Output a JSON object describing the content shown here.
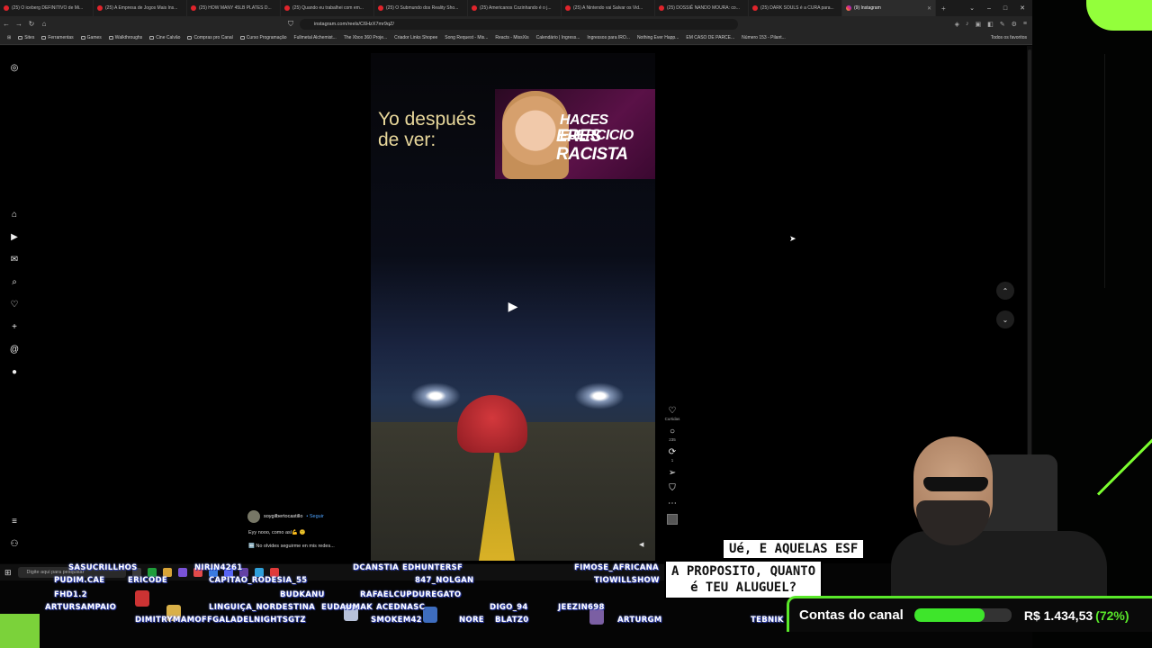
{
  "tabs": [
    {
      "label": "(25) O iceberg DEFINITIVO de Mi...",
      "active": false
    },
    {
      "label": "(25) A Empresa de Jogos Mais Ins...",
      "active": false
    },
    {
      "label": "(25) HOW MANY 45LB PLATES D...",
      "active": false
    },
    {
      "label": "(25) Quando eu trabalhei com em...",
      "active": false
    },
    {
      "label": "(25) O Submundo dos Reality Sho...",
      "active": false
    },
    {
      "label": "(25) Americanos Cozinhando é o j...",
      "active": false
    },
    {
      "label": "(25) A Nintendo vai Salvar os Vid...",
      "active": false
    },
    {
      "label": "(25) DOSSIÊ NANDO MOURA: co...",
      "active": false
    },
    {
      "label": "(25) DARK SOULS é a CURA para...",
      "active": false
    },
    {
      "label": "(9) Instagram",
      "active": true
    }
  ],
  "url": "instagram.com/reels/C6HzX7mr9qZ/",
  "bookmarks": [
    "Sites",
    "Ferramentas",
    "Games",
    "Walkthroughs",
    "Cine Calvão",
    "Compras pro Canal",
    "Curso Programação",
    "Fullmetal Alchemist...",
    "The Xbox 360 Proje...",
    "Criador Links Shopee",
    "Song Request - Mis...",
    "Reacts - MissXis",
    "Calendário | Ingress...",
    "Ingressos para IRO...",
    "Nothing Ever Happ...",
    "EM CASO DE PARCE...",
    "Número 153 - Pilant..."
  ],
  "bookmarks_all": "Todos os favoritos",
  "reel": {
    "caption_line1": "Yo después",
    "caption_line2": "de ver:",
    "thumb_line1": "HACES EJERCICIO",
    "thumb_line2": "ERES RACISTA",
    "owner": "soygilbertocastillo",
    "follow": "• Seguir",
    "desc1": "Eyy nooo, como así💪 🤨",
    "desc2": "🆓 No olvides seguirme en mis redes...",
    "likes_label": "Curtidas",
    "comments_count": "235",
    "reposts_count": "1"
  },
  "taskbar": {
    "search_placeholder": "Digite aqui para pesquisar"
  },
  "chat_nicks": [
    "SASUCRILLHOS",
    "NIRIN4261",
    "DCANSTIA",
    "EDHUNTERSF",
    "FIMOSE_AFRICANA",
    "PUDIM.CAE",
    "ERICODE",
    "CAPITAO_RODESIA_55",
    "847_NOLGAN",
    "TIOWILLSHOW",
    "FHD1.2",
    "BUDKANU",
    "RAFAELCUPDUREGATO",
    "ARTURSAMPAIO",
    "LINGUIÇA_NORDESTINA",
    "EUDAUMAK",
    "ACEDNASC",
    "DIGO_94",
    "JEEZIN698",
    "DIMITRYMAMOFFGALADELNIGHTSGTZ",
    "SMOKEM42",
    "NORE",
    "BLATZ0",
    "ARTURGM",
    "TEBNIK"
  ],
  "speech": {
    "line1": "Ué, E AQUELAS ESF",
    "line2": "A PROPOSITO, QUANTO",
    "line3": "é TEU ALUGUEL?"
  },
  "accounts": {
    "title": "Contas do canal",
    "amount": "R$ 1.434,53",
    "percent": "(72%)",
    "progress": 0.72
  },
  "colors": {
    "accent_green": "#59e82a",
    "follow_blue": "#4da3ff"
  }
}
